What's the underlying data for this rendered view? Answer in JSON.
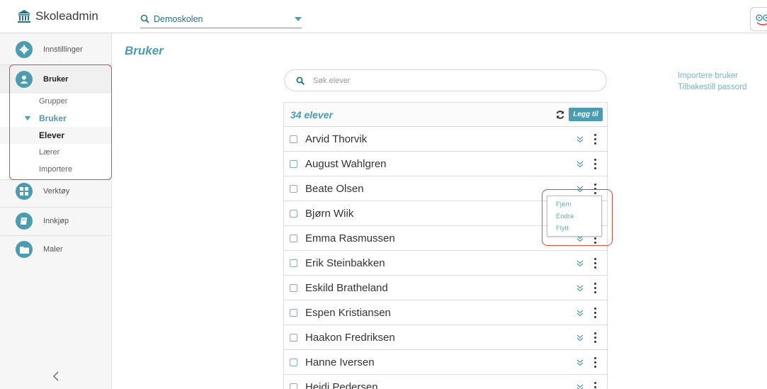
{
  "app": {
    "title": "Skoleadmin"
  },
  "school_selector": {
    "value": "Demoskolen"
  },
  "sidebar": {
    "items": [
      {
        "label": "Innstillinger",
        "icon": "gear-icon"
      },
      {
        "label": "Bruker",
        "icon": "user-icon"
      },
      {
        "label": "Verktøy",
        "icon": "grid-icon"
      },
      {
        "label": "Innkjøp",
        "icon": "book-icon"
      },
      {
        "label": "Maler",
        "icon": "folder-icon"
      }
    ],
    "sub_items": {
      "grupper": "Grupper",
      "bruker": "Bruker",
      "elever": "Elever",
      "laerer": "Lærer",
      "importere": "Importere"
    },
    "collapse_label": "<"
  },
  "main": {
    "title": "Bruker",
    "search": {
      "placeholder": "Søk elever"
    },
    "list": {
      "count_label": "34 elever",
      "add_label": "Legg til",
      "rows": [
        "Arvid Thorvik",
        "August Wahlgren",
        "Beate Olsen",
        "Bjørn Wiik",
        "Emma Rasmussen",
        "Erik Steinbakken",
        "Eskild Bratheland",
        "Espen Kristiansen",
        "Haakon Fredriksen",
        "Hanne Iversen",
        "Heidi Pedersen"
      ]
    },
    "row_menu": {
      "items": [
        "Fjern",
        "Endre",
        "Flytt"
      ]
    }
  },
  "right_links": {
    "import": "Importere bruker",
    "reset": "Tilbakestill passord"
  },
  "colors": {
    "accent": "#4b9cb0",
    "highlight": "#e0483e",
    "link": "#79b6c6"
  }
}
